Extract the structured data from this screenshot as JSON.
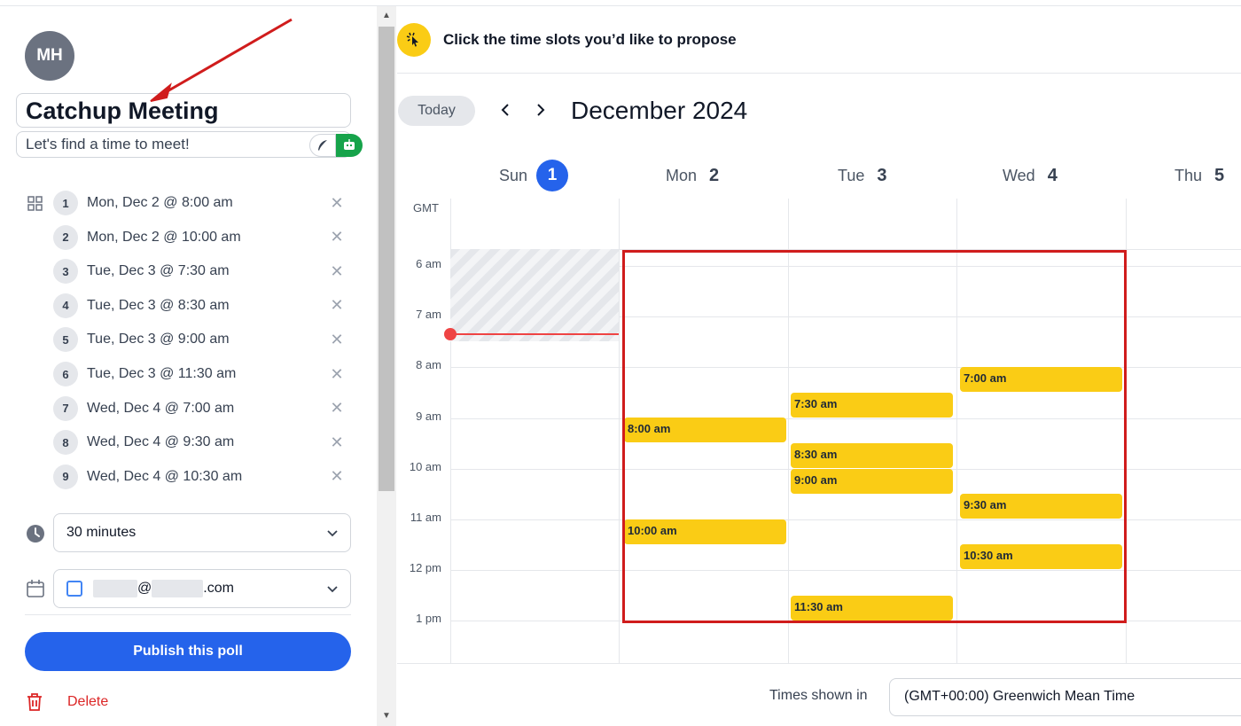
{
  "poll": {
    "avatar_initials": "MH",
    "title": "Catchup Meeting",
    "description": "Let's find a time to meet!",
    "slots": [
      {
        "num": "1",
        "label": "Mon, Dec 2 @ 8:00 am"
      },
      {
        "num": "2",
        "label": "Mon, Dec 2 @ 10:00 am"
      },
      {
        "num": "3",
        "label": "Tue, Dec 3 @ 7:30 am"
      },
      {
        "num": "4",
        "label": "Tue, Dec 3 @ 8:30 am"
      },
      {
        "num": "5",
        "label": "Tue, Dec 3 @ 9:00 am"
      },
      {
        "num": "6",
        "label": "Tue, Dec 3 @ 11:30 am"
      },
      {
        "num": "7",
        "label": "Wed, Dec 4 @ 7:00 am"
      },
      {
        "num": "8",
        "label": "Wed, Dec 4 @ 9:30 am"
      },
      {
        "num": "9",
        "label": "Wed, Dec 4 @ 10:30 am"
      }
    ],
    "duration": "30 minutes",
    "calendar_account_at": "@",
    "calendar_account_tld": ".com",
    "publish_label": "Publish this poll",
    "delete_label": "Delete"
  },
  "calendar": {
    "banner": "Click the time slots you’d like to propose",
    "today_label": "Today",
    "month": "December 2024",
    "days": [
      {
        "name": "Sun",
        "num": "1",
        "today": true
      },
      {
        "name": "Mon",
        "num": "2"
      },
      {
        "name": "Tue",
        "num": "3"
      },
      {
        "name": "Wed",
        "num": "4"
      },
      {
        "name": "Thu",
        "num": "5"
      }
    ],
    "tz_short": "GMT",
    "hours": [
      "6 am",
      "7 am",
      "8 am",
      "9 am",
      "10 am",
      "11 am",
      "12 pm",
      "1 pm"
    ],
    "blocks": [
      {
        "day": "Mon",
        "time": "8:00 am"
      },
      {
        "day": "Mon",
        "time": "10:00 am"
      },
      {
        "day": "Tue",
        "time": "7:30 am"
      },
      {
        "day": "Tue",
        "time": "8:30 am"
      },
      {
        "day": "Tue",
        "time": "9:00 am"
      },
      {
        "day": "Tue",
        "time": "11:30 am"
      },
      {
        "day": "Wed",
        "time": "7:00 am"
      },
      {
        "day": "Wed",
        "time": "9:30 am"
      },
      {
        "day": "Wed",
        "time": "10:30 am"
      }
    ],
    "times_shown_label": "Times shown in",
    "timezone": "(GMT+00:00) Greenwich Mean Time"
  },
  "colors": {
    "accent": "#2563eb",
    "slot": "#facc15",
    "danger": "#dc2626",
    "annotation": "#d01c1c"
  }
}
